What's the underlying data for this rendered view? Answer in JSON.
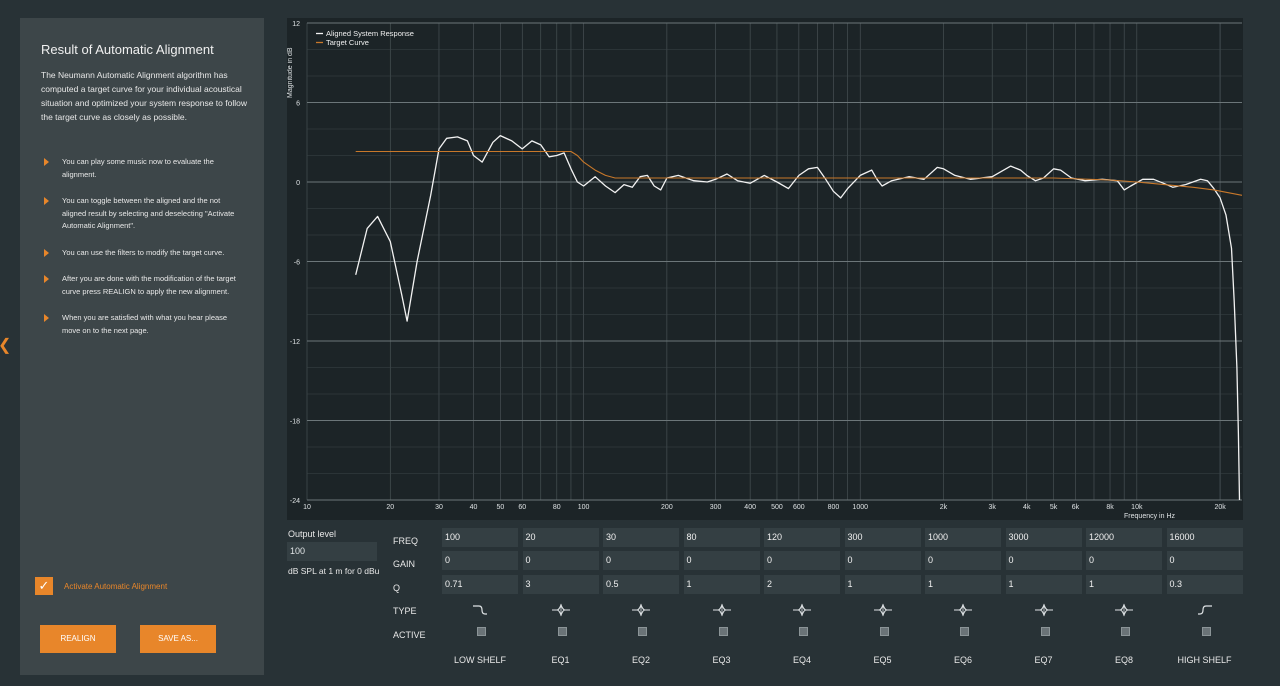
{
  "panel": {
    "title": "Result of Automatic Alignment",
    "intro": "The Neumann Automatic Alignment algorithm has computed a target curve for your individual acoustical situation and optimized your system response to follow the target curve as closely as possible.",
    "bullets": [
      "You can play some music now to evaluate the alignment.",
      "You can toggle between the aligned and the not aligned result by selecting and deselecting \"Activate Automatic Alignment\".",
      "You can use the filters to modify the target curve.",
      "After you are done with the modification of the target curve press REALIGN to apply the new alignment.",
      "When you are satisfied with what you hear please move on to the next page."
    ],
    "activate_label": "Activate Automatic Alignment",
    "activate_checked": true,
    "realign_label": "REALIGN",
    "save_label": "SAVE AS..."
  },
  "output": {
    "label": "Output level",
    "value": "100",
    "unit": "dB SPL at 1 m for 0 dBu"
  },
  "filters": {
    "row_labels": {
      "freq": "FREQ",
      "gain": "GAIN",
      "q": "Q",
      "type": "TYPE",
      "active": "ACTIVE"
    },
    "columns": [
      {
        "name": "LOW SHELF",
        "freq": "100",
        "gain": "0",
        "q": "0.71",
        "type": "low-shelf-icon"
      },
      {
        "name": "EQ1",
        "freq": "20",
        "gain": "0",
        "q": "3",
        "type": "peak-eq-icon"
      },
      {
        "name": "EQ2",
        "freq": "30",
        "gain": "0",
        "q": "0.5",
        "type": "peak-eq-icon"
      },
      {
        "name": "EQ3",
        "freq": "80",
        "gain": "0",
        "q": "1",
        "type": "peak-eq-icon"
      },
      {
        "name": "EQ4",
        "freq": "120",
        "gain": "0",
        "q": "2",
        "type": "peak-eq-icon"
      },
      {
        "name": "EQ5",
        "freq": "300",
        "gain": "0",
        "q": "1",
        "type": "peak-eq-icon"
      },
      {
        "name": "EQ6",
        "freq": "1000",
        "gain": "0",
        "q": "1",
        "type": "peak-eq-icon"
      },
      {
        "name": "EQ7",
        "freq": "3000",
        "gain": "0",
        "q": "1",
        "type": "peak-eq-icon"
      },
      {
        "name": "EQ8",
        "freq": "12000",
        "gain": "0",
        "q": "1",
        "type": "peak-eq-icon"
      },
      {
        "name": "HIGH SHELF",
        "freq": "16000",
        "gain": "0",
        "q": "0.3",
        "type": "high-shelf-icon"
      }
    ]
  },
  "chart_data": {
    "type": "line",
    "ylabel": "Magnitude in dB",
    "xlabel": "Frequency in Hz",
    "x_scale": "log",
    "xlim": [
      10,
      24000
    ],
    "ylim": [
      -24,
      12
    ],
    "y_ticks": [
      12,
      6,
      0,
      -6,
      -12,
      -18,
      -24
    ],
    "x_ticks": [
      {
        "v": 10,
        "label": "10"
      },
      {
        "v": 20,
        "label": "20"
      },
      {
        "v": 30,
        "label": "30"
      },
      {
        "v": 40,
        "label": "40"
      },
      {
        "v": 50,
        "label": "50"
      },
      {
        "v": 60,
        "label": "60"
      },
      {
        "v": 80,
        "label": "80"
      },
      {
        "v": 100,
        "label": "100"
      },
      {
        "v": 200,
        "label": "200"
      },
      {
        "v": 300,
        "label": "300"
      },
      {
        "v": 400,
        "label": "400"
      },
      {
        "v": 500,
        "label": "500"
      },
      {
        "v": 600,
        "label": "600"
      },
      {
        "v": 800,
        "label": "800"
      },
      {
        "v": 1000,
        "label": "1000"
      },
      {
        "v": 2000,
        "label": "2k"
      },
      {
        "v": 3000,
        "label": "3k"
      },
      {
        "v": 4000,
        "label": "4k"
      },
      {
        "v": 5000,
        "label": "5k"
      },
      {
        "v": 6000,
        "label": "6k"
      },
      {
        "v": 8000,
        "label": "8k"
      },
      {
        "v": 10000,
        "label": "10k"
      },
      {
        "v": 20000,
        "label": "20k"
      }
    ],
    "grid": true,
    "legend": "top-left",
    "series": [
      {
        "name": "Aligned System Response",
        "color": "#f2f2f2",
        "points": [
          [
            15,
            -7
          ],
          [
            16.5,
            -3.5
          ],
          [
            18,
            -2.6
          ],
          [
            20,
            -4.5
          ],
          [
            22,
            -8.5
          ],
          [
            23,
            -10.5
          ],
          [
            25,
            -6
          ],
          [
            28,
            -1
          ],
          [
            30,
            2.5
          ],
          [
            32,
            3.3
          ],
          [
            35,
            3.4
          ],
          [
            38,
            3.1
          ],
          [
            40,
            2
          ],
          [
            43,
            1.5
          ],
          [
            47,
            3
          ],
          [
            50,
            3.5
          ],
          [
            55,
            3.1
          ],
          [
            60,
            2.5
          ],
          [
            65,
            3.1
          ],
          [
            70,
            2.8
          ],
          [
            75,
            1.9
          ],
          [
            80,
            2
          ],
          [
            85,
            2.2
          ],
          [
            90,
            1
          ],
          [
            95,
            0
          ],
          [
            100,
            -0.3
          ],
          [
            110,
            0.4
          ],
          [
            120,
            -0.3
          ],
          [
            130,
            -0.8
          ],
          [
            140,
            -0.2
          ],
          [
            150,
            -0.4
          ],
          [
            160,
            0.4
          ],
          [
            170,
            0.5
          ],
          [
            180,
            -0.3
          ],
          [
            190,
            -0.6
          ],
          [
            200,
            0.3
          ],
          [
            220,
            0.5
          ],
          [
            250,
            0.1
          ],
          [
            280,
            0
          ],
          [
            300,
            0.2
          ],
          [
            330,
            0.6
          ],
          [
            360,
            0.1
          ],
          [
            400,
            -0.1
          ],
          [
            450,
            0.5
          ],
          [
            500,
            0
          ],
          [
            550,
            -0.5
          ],
          [
            600,
            0.5
          ],
          [
            650,
            1
          ],
          [
            700,
            1.1
          ],
          [
            750,
            0.2
          ],
          [
            800,
            -0.7
          ],
          [
            850,
            -1.2
          ],
          [
            900,
            -0.5
          ],
          [
            1000,
            0.5
          ],
          [
            1100,
            0.9
          ],
          [
            1150,
            0.2
          ],
          [
            1200,
            -0.3
          ],
          [
            1300,
            0.1
          ],
          [
            1500,
            0.4
          ],
          [
            1700,
            0.2
          ],
          [
            1900,
            1.1
          ],
          [
            2000,
            1
          ],
          [
            2200,
            0.5
          ],
          [
            2500,
            0.2
          ],
          [
            3000,
            0.4
          ],
          [
            3500,
            1.2
          ],
          [
            3800,
            0.9
          ],
          [
            4000,
            0.5
          ],
          [
            4300,
            0.1
          ],
          [
            4600,
            0.3
          ],
          [
            5000,
            1
          ],
          [
            5300,
            0.9
          ],
          [
            5800,
            0.3
          ],
          [
            6500,
            0.1
          ],
          [
            7500,
            0.2
          ],
          [
            8500,
            0.1
          ],
          [
            9000,
            -0.6
          ],
          [
            9500,
            -0.3
          ],
          [
            10500,
            0.2
          ],
          [
            11500,
            0.2
          ],
          [
            12500,
            -0.1
          ],
          [
            13500,
            -0.4
          ],
          [
            15000,
            -0.2
          ],
          [
            17000,
            0.2
          ],
          [
            18000,
            0.1
          ],
          [
            19000,
            -0.5
          ],
          [
            20000,
            -1.2
          ],
          [
            21000,
            -2.5
          ],
          [
            22000,
            -5
          ],
          [
            22500,
            -9
          ],
          [
            23000,
            -14
          ],
          [
            23300,
            -19
          ],
          [
            23500,
            -24
          ]
        ]
      },
      {
        "name": "Target Curve",
        "color": "#c8782a",
        "points": [
          [
            15,
            2.3
          ],
          [
            90,
            2.3
          ],
          [
            95,
            2
          ],
          [
            100,
            1.5
          ],
          [
            110,
            0.9
          ],
          [
            120,
            0.5
          ],
          [
            130,
            0.3
          ],
          [
            150,
            0.3
          ],
          [
            5000,
            0.3
          ],
          [
            8000,
            0.15
          ],
          [
            10000,
            0
          ],
          [
            16000,
            -0.4
          ],
          [
            19000,
            -0.6
          ],
          [
            24000,
            -1
          ]
        ]
      }
    ]
  }
}
